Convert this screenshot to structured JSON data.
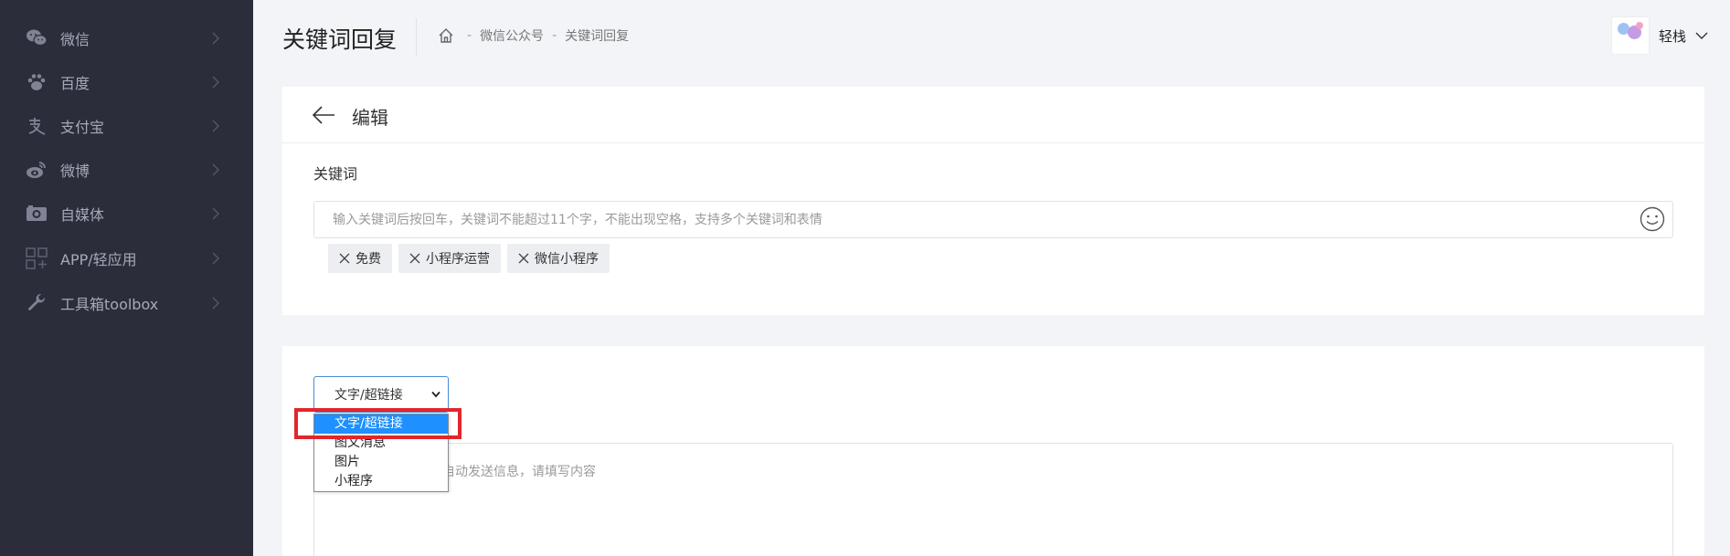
{
  "sidebar": {
    "items": [
      {
        "label": "微信",
        "icon": "wechat-icon"
      },
      {
        "label": "百度",
        "icon": "paw-icon"
      },
      {
        "label": "支付宝",
        "icon": "alipay-icon"
      },
      {
        "label": "微博",
        "icon": "weibo-icon"
      },
      {
        "label": "自媒体",
        "icon": "media-icon"
      },
      {
        "label": "APP/轻应用",
        "icon": "app-grid-icon"
      },
      {
        "label": "工具箱toolbox",
        "icon": "wrench-icon"
      }
    ]
  },
  "header": {
    "title": "关键词回复",
    "breadcrumb": [
      "微信公众号",
      "关键词回复"
    ],
    "breadcrumb_sep": "-",
    "user": {
      "name": "轻栈"
    }
  },
  "edit_card": {
    "title": "编辑",
    "keyword_label": "关键词",
    "keyword_placeholder": "输入关键词后按回车，关键词不能超过11个字，不能出现空格，支持多个关键词和表情",
    "tags": [
      "免费",
      "小程序运营",
      "微信小程序"
    ]
  },
  "reply_card": {
    "select_value": "文字/超链接",
    "options": [
      "文字/超链接",
      "图文消息",
      "图片",
      "小程序"
    ],
    "textarea_placeholder": "自动发送信息，请填写内容"
  },
  "colors": {
    "sidebar_bg": "#2b2d3b",
    "page_bg": "#f3f4f8",
    "selected_option": "#1e90ff",
    "highlight": "#e2262c"
  }
}
